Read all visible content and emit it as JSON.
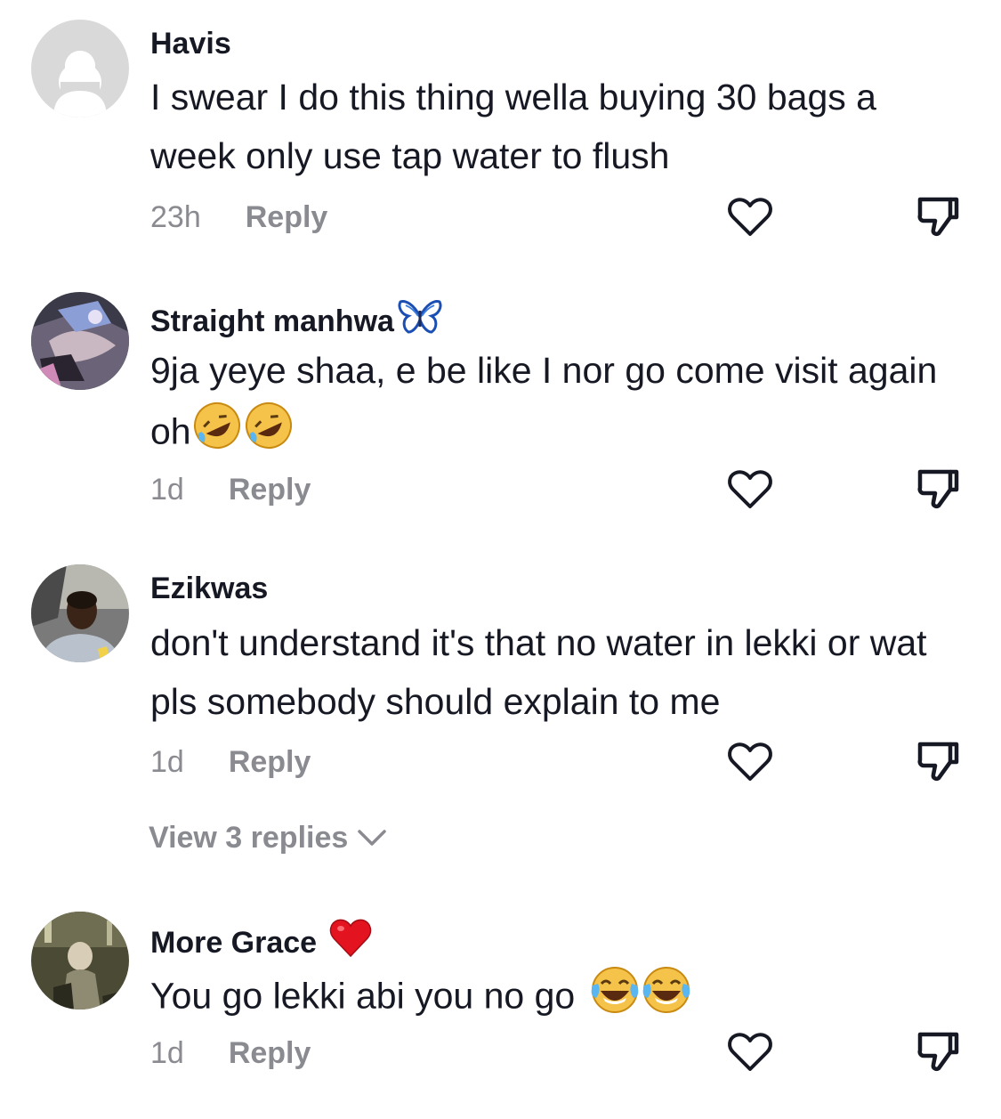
{
  "comments": [
    {
      "username": "Havis",
      "text": "I swear I do this thing wella buying 30 bags a week only use tap water to flush",
      "time": "23h",
      "reply_label": "Reply",
      "avatar": "default-avatar"
    },
    {
      "username": "Straight manhwa",
      "username_emoji": "butterfly",
      "text": "9ja yeye shaa, e be like I nor go come visit again oh",
      "text_emojis": [
        "rolling-on-floor-laughing",
        "rolling-on-floor-laughing"
      ],
      "time": "1d",
      "reply_label": "Reply",
      "avatar": "anime-avatar"
    },
    {
      "username": "Ezikwas",
      "text": "don't understand it's that no water in lekki or wat pls somebody should explain to me",
      "time": "1d",
      "reply_label": "Reply",
      "view_replies": "View 3 replies",
      "avatar": "photo-avatar"
    },
    {
      "username": "More Grace",
      "username_emoji": "red-heart",
      "text": "You go lekki abi you no go",
      "text_emojis": [
        "face-with-tears-of-joy",
        "face-with-tears-of-joy"
      ],
      "time": "1d",
      "reply_label": "Reply",
      "avatar": "photo-avatar"
    }
  ],
  "icons": {
    "like": "heart-outline-icon",
    "dislike": "thumbs-down-icon",
    "expand": "chevron-down-icon"
  },
  "colors": {
    "text": "#161823",
    "secondary": "#8a8b91",
    "icon": "#161823"
  }
}
